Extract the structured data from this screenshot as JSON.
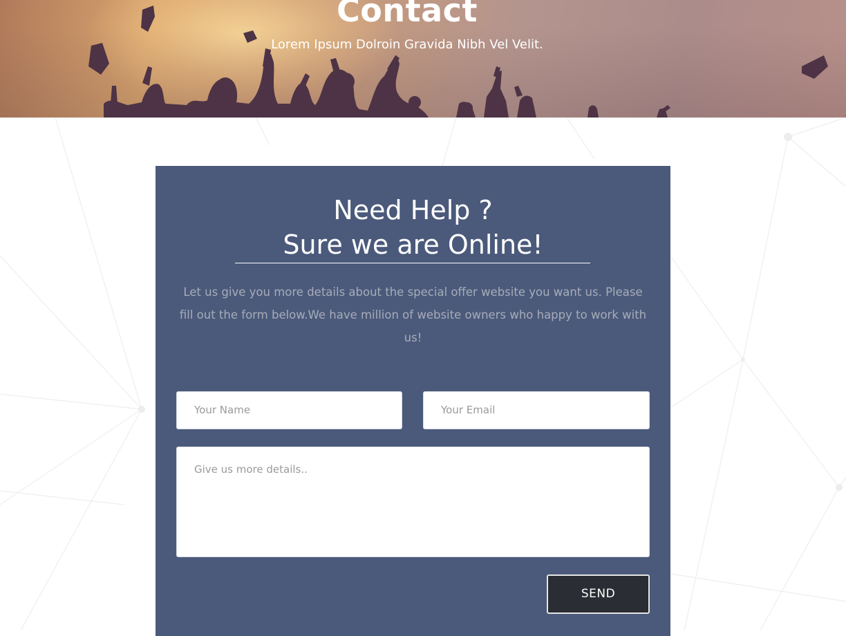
{
  "hero": {
    "title": "Contact",
    "subtitle": "Lorem Ipsum Dolroin Gravida Nibh Vel Velit."
  },
  "form_card": {
    "heading_line1": "Need Help ?",
    "heading_line2": "Sure we are Online!",
    "description": "Let us give you more details about the special offer website you want us. Please fill out the form below.We have million of website owners who happy to work with us!",
    "name_placeholder": "Your Name",
    "email_placeholder": "Your Email",
    "details_placeholder": "Give us more details..",
    "send_label": "SEND"
  },
  "colors": {
    "card_background": "#4b5a7b",
    "send_button": "#2a2d33",
    "description_text": "#a7acb8"
  }
}
